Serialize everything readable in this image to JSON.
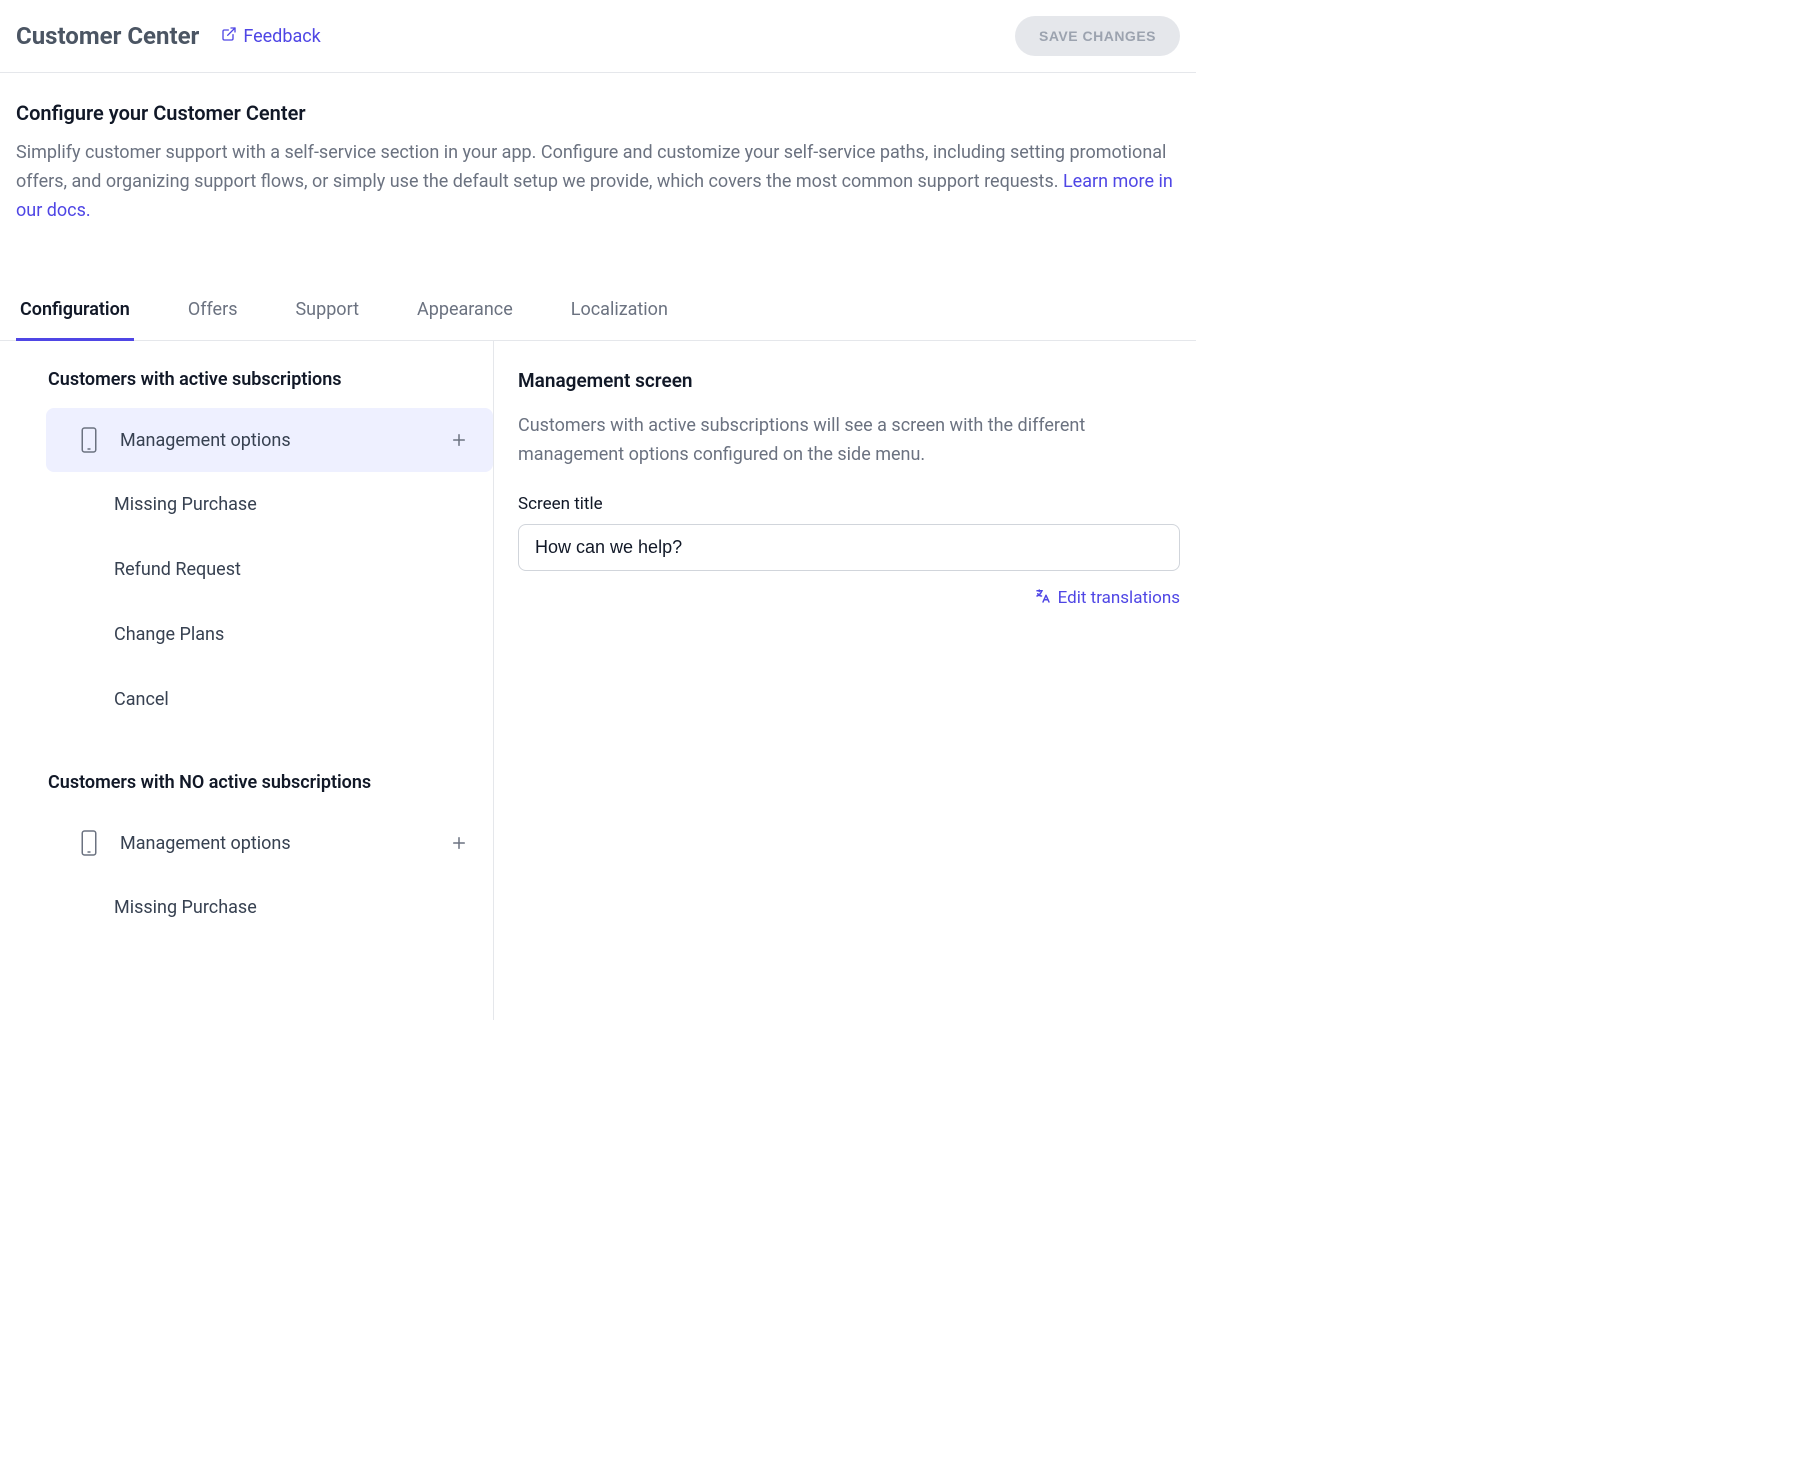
{
  "header": {
    "title": "Customer Center",
    "feedback_label": "Feedback",
    "save_label": "SAVE CHANGES"
  },
  "intro": {
    "heading": "Configure your Customer Center",
    "text": "Simplify customer support with a self-service section in your app. Configure and customize your self-service paths, including setting promotional offers, and organizing support flows, or simply use the default setup we provide, which covers the most common support requests. ",
    "link_text": "Learn more in our docs."
  },
  "tabs": [
    {
      "label": "Configuration",
      "active": true
    },
    {
      "label": "Offers",
      "active": false
    },
    {
      "label": "Support",
      "active": false
    },
    {
      "label": "Appearance",
      "active": false
    },
    {
      "label": "Localization",
      "active": false
    }
  ],
  "sidebar": {
    "groups": [
      {
        "title": "Customers with active subscriptions",
        "management_label": "Management options",
        "selected": true,
        "items": [
          {
            "label": "Missing Purchase"
          },
          {
            "label": "Refund Request"
          },
          {
            "label": "Change Plans"
          },
          {
            "label": "Cancel"
          }
        ]
      },
      {
        "title": "Customers with NO active subscriptions",
        "management_label": "Management options",
        "selected": false,
        "items": [
          {
            "label": "Missing Purchase"
          }
        ]
      }
    ]
  },
  "detail": {
    "heading": "Management screen",
    "description": "Customers with active subscriptions will see a screen with the different management options configured on the side menu.",
    "field_label": "Screen title",
    "field_value": "How can we help?",
    "edit_translations_label": "Edit translations"
  }
}
